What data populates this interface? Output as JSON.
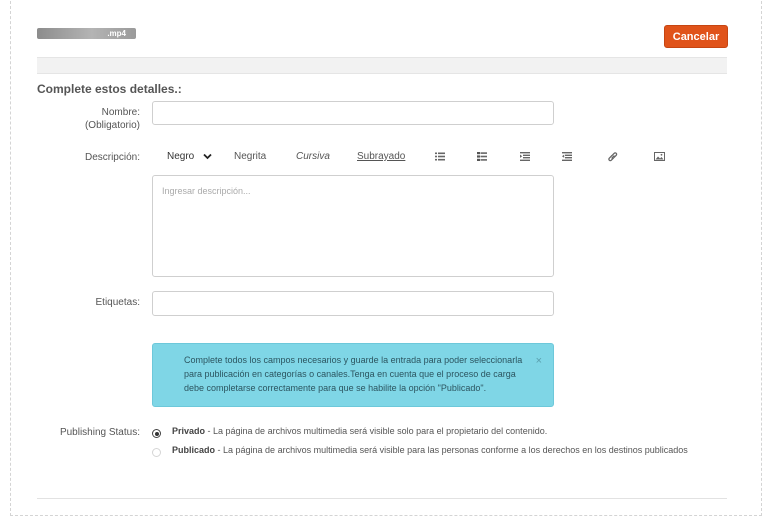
{
  "upload": {
    "file_name": ".mp4",
    "cancel_label": "Cancelar"
  },
  "form": {
    "section_title": "Complete estos detalles.:",
    "name_label_line1": "Nombre:",
    "name_label_line2": "(Obligatorio)",
    "name_value": "",
    "description_label": "Descripción:",
    "description_placeholder": "Ingresar descripción...",
    "tags_label": "Etiquetas:",
    "tags_value": ""
  },
  "toolbar": {
    "format_select": "Negro",
    "bold": "Negrita",
    "italic": "Cursiva",
    "underline": "Subrayado",
    "icons": [
      "bulleted-list-icon",
      "numbered-list-icon",
      "outdent-icon",
      "indent-icon",
      "link-icon",
      "image-icon"
    ]
  },
  "alert": {
    "message": "Complete todos los campos necesarios y guarde la entrada para poder seleccionarla para publicación en categorías o canales.Tenga en cuenta que el proceso de carga debe completarse correctamente para que se habilite la opción \"Publicado\".",
    "close": "×"
  },
  "publishing": {
    "label": "Publishing Status:",
    "options": [
      {
        "title": "Privado",
        "desc": " - La página de archivos multimedia será visible solo para el propietario del contenido.",
        "selected": true
      },
      {
        "title": "Publicado",
        "desc": " - La página de archivos multimedia será visible para las personas conforme a los derechos en los destinos publicados",
        "selected": false
      }
    ]
  },
  "colors": {
    "accent": "#e0531a",
    "alert_bg": "#7fd6e6"
  }
}
